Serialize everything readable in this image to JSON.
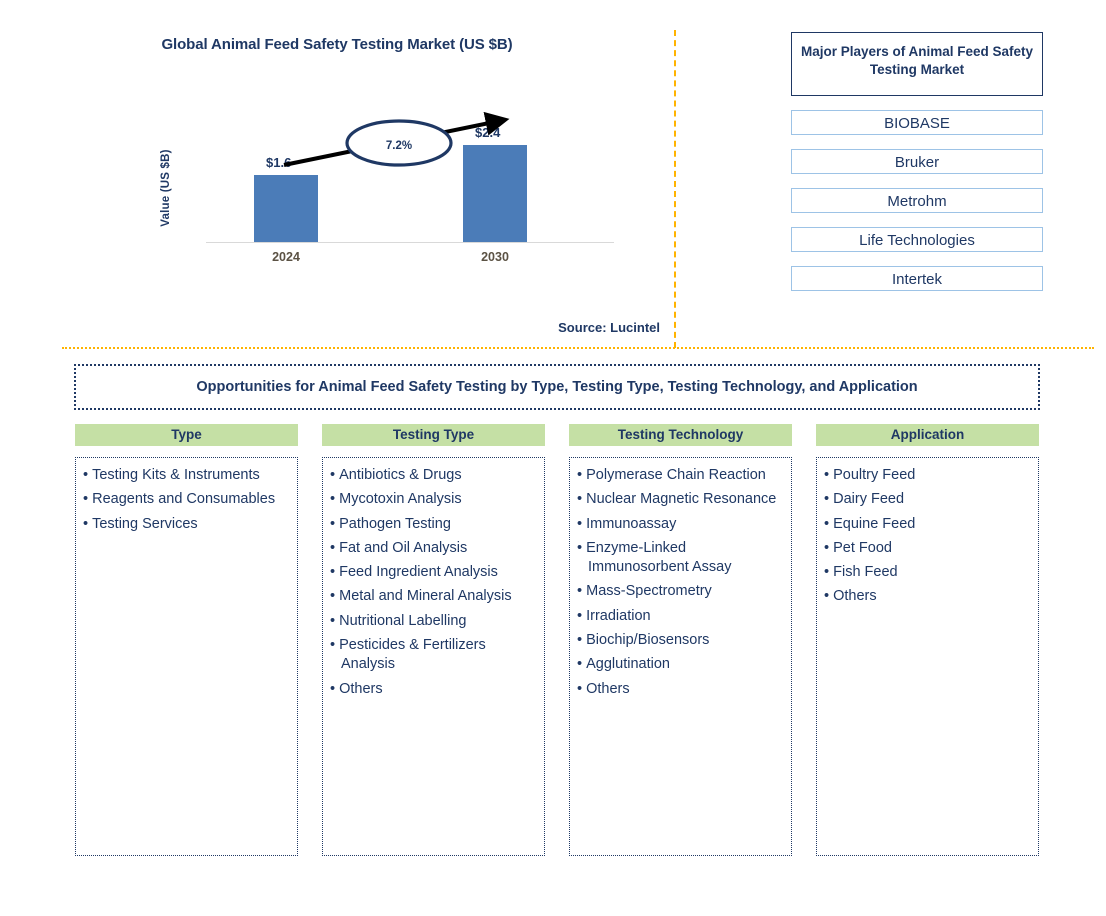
{
  "chart_panel": {
    "title": "Global Animal Feed Safety Testing Market (US $B)",
    "source": "Source: Lucintel",
    "ylabel": "Value (US $B)",
    "cagr": "7.2%",
    "value_2024": "$1.6",
    "value_2030": "$2.4",
    "x_2024": "2024",
    "x_2030": "2030"
  },
  "chart_data": {
    "type": "bar",
    "title": "Global Animal Feed Safety Testing Market (US $B)",
    "categories": [
      "2024",
      "2030"
    ],
    "values": [
      1.6,
      2.4
    ],
    "data_labels": [
      "$1.6",
      "$2.4"
    ],
    "xlabel": "",
    "ylabel": "Value (US $B)",
    "ylim": [
      0,
      2.8
    ],
    "grid": false,
    "legend": "none",
    "annotation": {
      "cagr_label": "7.2%",
      "shape": "ellipse-on-arrow",
      "arrow_from": "2024",
      "arrow_to": "2030"
    },
    "series_color": "#4b7cb8",
    "source": "Source: Lucintel"
  },
  "players": {
    "header": "Major Players of Animal Feed Safety Testing Market",
    "items": [
      {
        "label": "BIOBASE"
      },
      {
        "label": "Bruker"
      },
      {
        "label": "Metrohm"
      },
      {
        "label": "Life Technologies"
      },
      {
        "label": "Intertek"
      }
    ]
  },
  "opportunities": {
    "banner": "Opportunities for Animal Feed Safety Testing by Type, Testing Type, Testing Technology, and Application",
    "columns": [
      {
        "header": "Type",
        "items": [
          "Testing Kits & Instruments",
          "Reagents and Consumables",
          "Testing Services"
        ]
      },
      {
        "header": "Testing Type",
        "items": [
          "Antibiotics & Drugs",
          "Mycotoxin Analysis",
          "Pathogen Testing",
          "Fat and Oil Analysis",
          "Feed Ingredient Analysis",
          "Metal and Mineral Analysis",
          "Nutritional Labelling",
          "Pesticides & Fertilizers Analysis",
          "Others"
        ]
      },
      {
        "header": "Testing Technology",
        "items": [
          "Polymerase Chain Reaction",
          "Nuclear Magnetic Resonance",
          "Immunoassay",
          "Enzyme-Linked Immunosorbent Assay",
          "Mass-Spectrometry",
          "Irradiation",
          "Biochip/Biosensors",
          "Agglutination",
          "Others"
        ]
      },
      {
        "header": "Application",
        "items": [
          "Poultry Feed",
          "Dairy Feed",
          "Equine Feed",
          "Pet Food",
          "Fish Feed",
          "Others"
        ]
      }
    ]
  },
  "colors": {
    "bar": "#4b7cb8",
    "navy": "#1f3864",
    "green_header": "#c5e0a5",
    "divider_orange": "#ffb300",
    "player_border": "#9dc3e6"
  }
}
